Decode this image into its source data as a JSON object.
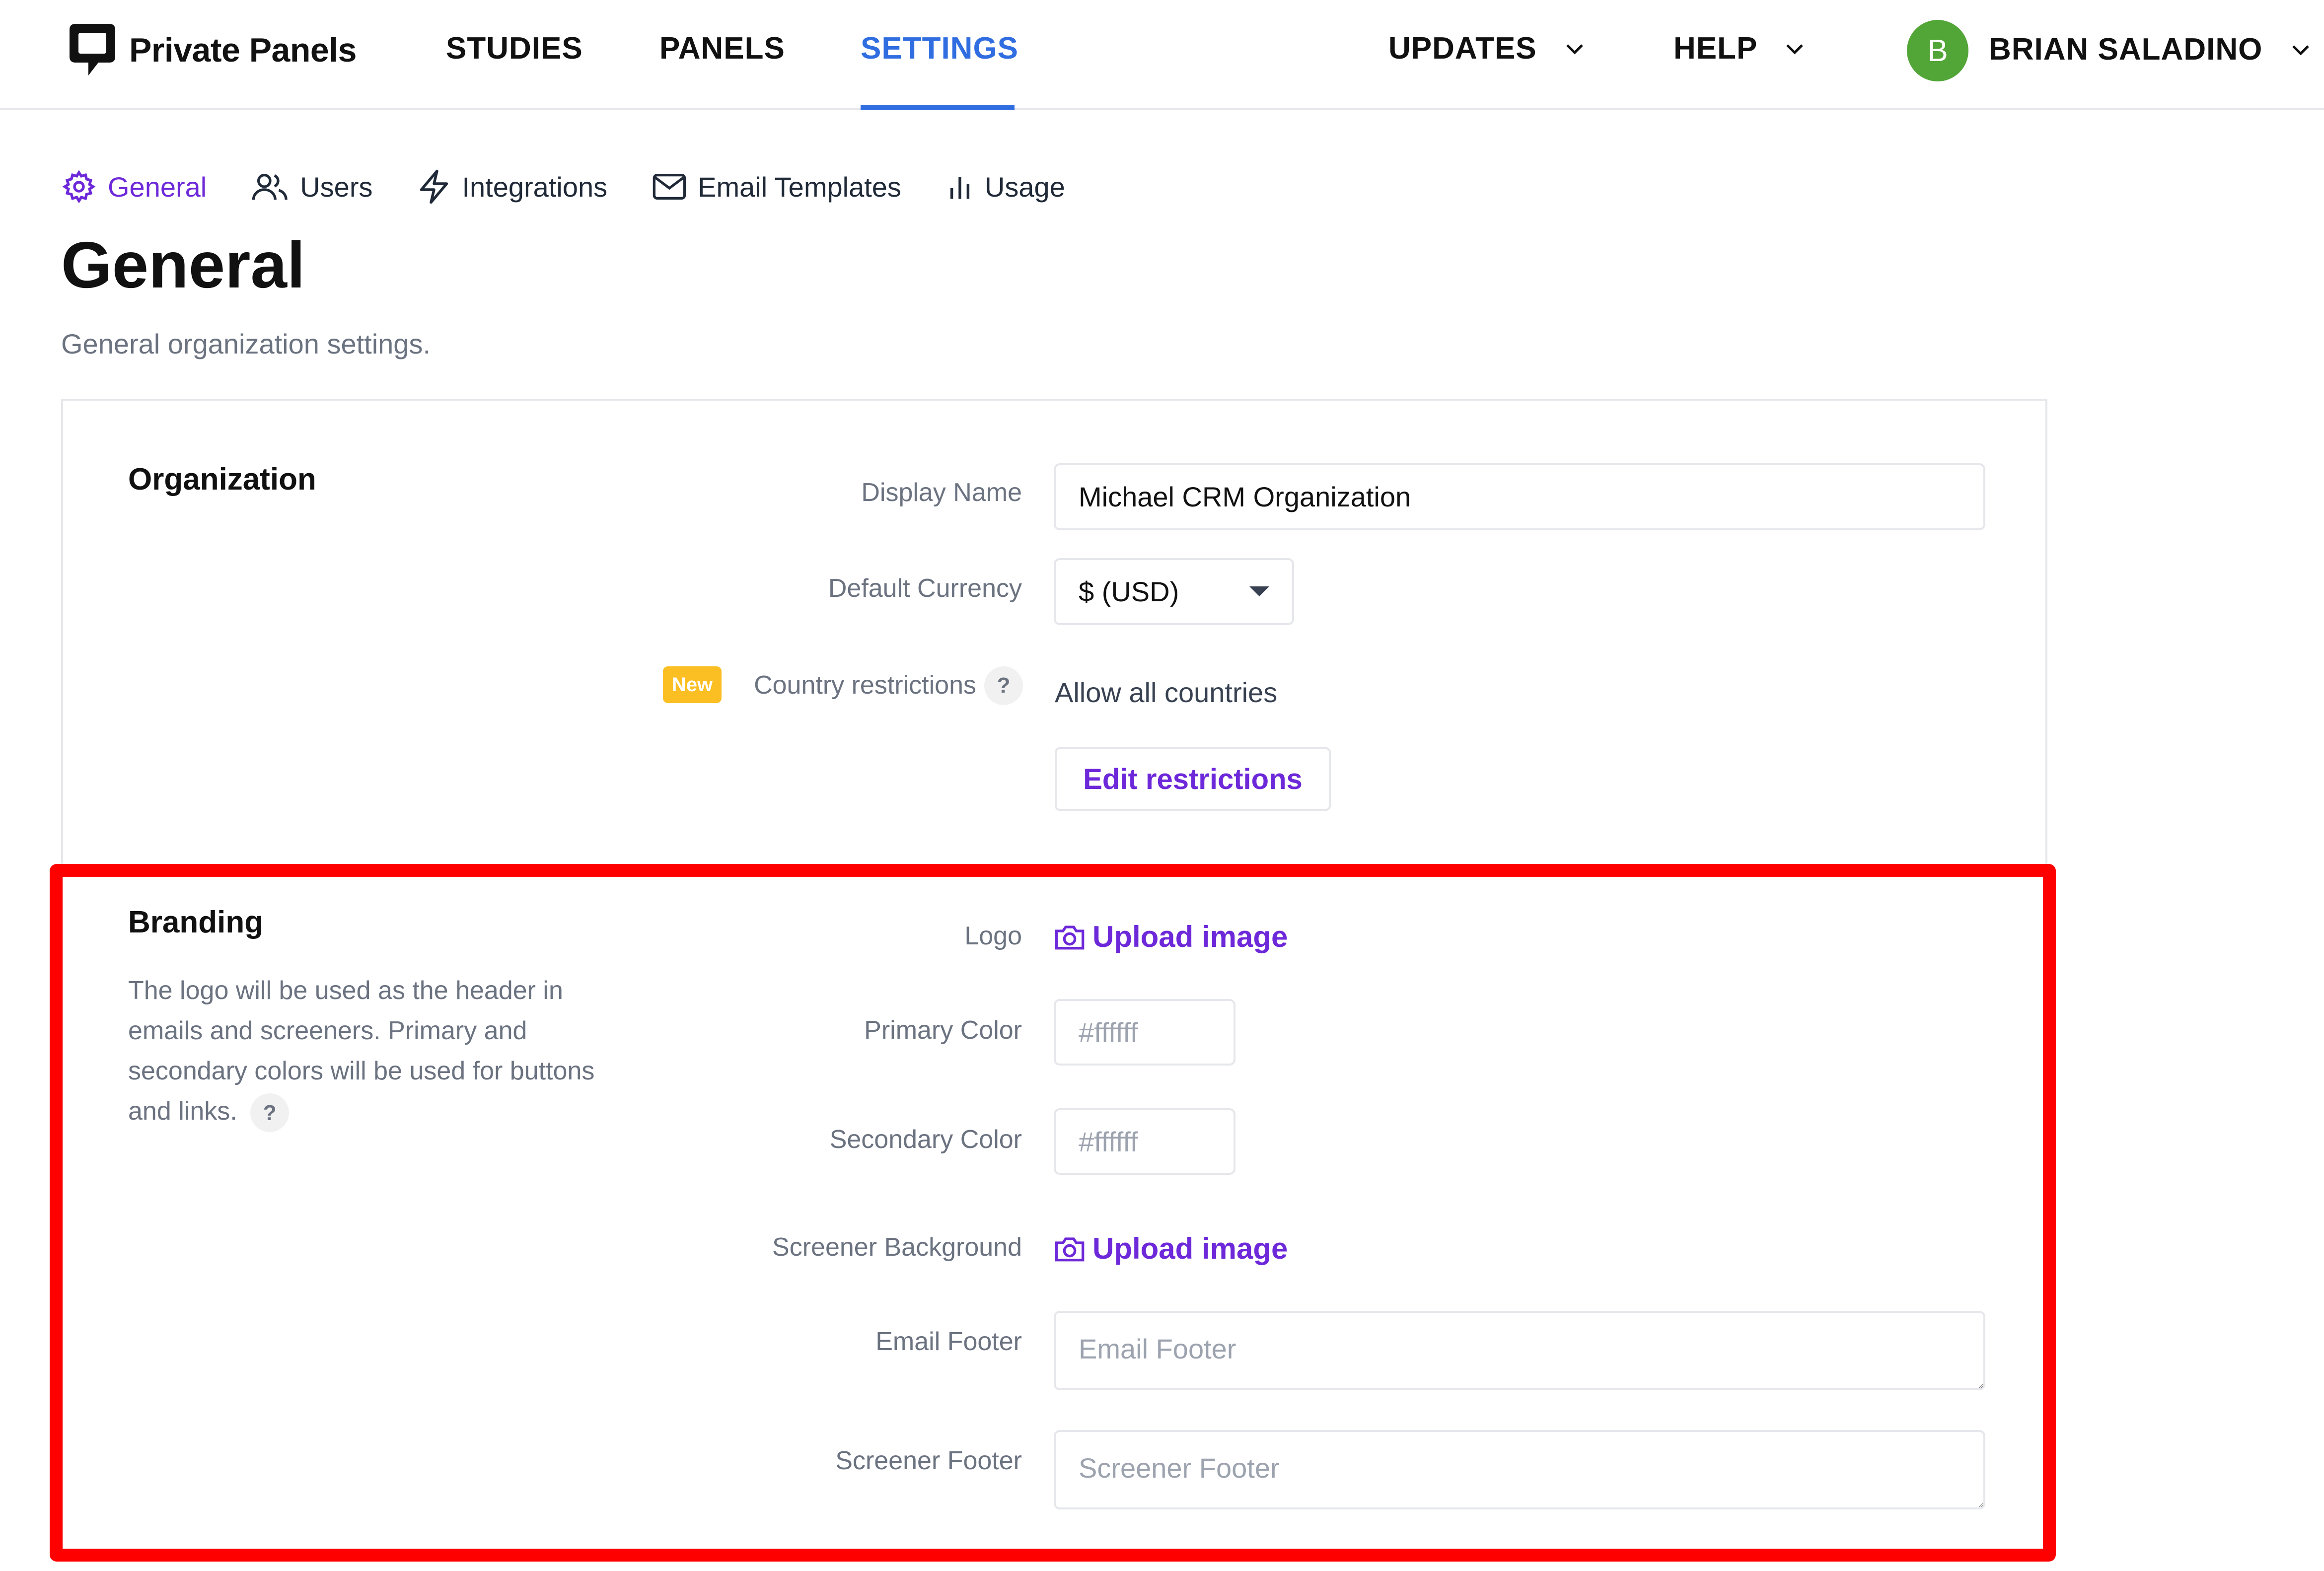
{
  "header": {
    "brand": "Private Panels",
    "nav": {
      "studies": "STUDIES",
      "panels": "PANELS",
      "settings": "SETTINGS",
      "updates": "UPDATES",
      "help": "HELP"
    },
    "user": {
      "initial": "B",
      "name": "BRIAN SALADINO",
      "avatar_color": "#52a537"
    }
  },
  "tabs": {
    "general": "General",
    "users": "Users",
    "integrations": "Integrations",
    "email_templates": "Email Templates",
    "usage": "Usage"
  },
  "page": {
    "title": "General",
    "subtitle": "General organization settings."
  },
  "organization": {
    "title": "Organization",
    "display_name_label": "Display Name",
    "display_name_value": "Michael CRM Organization",
    "currency_label": "Default Currency",
    "currency_value": "$ (USD)",
    "new_badge": "New",
    "country_label": "Country restrictions",
    "help": "?",
    "country_value": "Allow all countries",
    "edit_button": "Edit restrictions"
  },
  "branding": {
    "title": "Branding",
    "description": "The logo will be used as the header in emails and screeners. Primary and secondary colors will be used for buttons and links.",
    "help": "?",
    "logo_label": "Logo",
    "upload_label": "Upload image",
    "primary_color_label": "Primary Color",
    "primary_color_placeholder": "#ffffff",
    "secondary_color_label": "Secondary Color",
    "secondary_color_placeholder": "#ffffff",
    "screener_bg_label": "Screener Background",
    "screener_bg_upload": "Upload image",
    "email_footer_label": "Email Footer",
    "email_footer_placeholder": "Email Footer",
    "screener_footer_label": "Screener Footer",
    "screener_footer_placeholder": "Screener Footer"
  },
  "colors": {
    "accent": "#2f6de1",
    "purple": "#6d28d9",
    "highlight": "#ff0000",
    "badge": "#fbbf24"
  }
}
